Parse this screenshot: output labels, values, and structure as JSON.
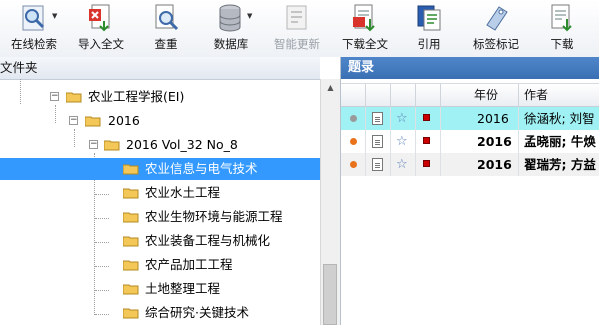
{
  "toolbar": {
    "items": [
      {
        "label": "在线检索",
        "icon": "online-search-icon",
        "enabled": true,
        "dropdown": true
      },
      {
        "label": "导入全文",
        "icon": "import-fulltext-icon",
        "enabled": true
      },
      {
        "label": "查重",
        "icon": "duplicate-check-icon",
        "enabled": true
      },
      {
        "label": "数据库",
        "icon": "database-icon",
        "enabled": true,
        "dropdown": true
      },
      {
        "label": "智能更新",
        "icon": "smart-update-icon",
        "enabled": false
      },
      {
        "label": "下载全文",
        "icon": "download-fulltext-icon",
        "enabled": true
      },
      {
        "label": "引用",
        "icon": "cite-icon",
        "enabled": true
      },
      {
        "label": "标签标记",
        "icon": "tag-icon",
        "enabled": true
      },
      {
        "label": "下载",
        "icon": "download-icon",
        "enabled": true
      }
    ]
  },
  "left_panel": {
    "title": "文件夹",
    "tree": [
      {
        "label": "农业工程学报(EI)",
        "expanded": true
      },
      {
        "label": "2016",
        "expanded": true
      },
      {
        "label": "2016 Vol_32 No_8",
        "expanded": true
      },
      {
        "label": "农业信息与电气技术",
        "selected": true
      },
      {
        "label": "农业水土工程"
      },
      {
        "label": "农业生物环境与能源工程"
      },
      {
        "label": "农业装备工程与机械化"
      },
      {
        "label": "农产品加工工程"
      },
      {
        "label": "土地整理工程"
      },
      {
        "label": "综合研究·关键技术"
      }
    ]
  },
  "right_panel": {
    "title": "题录",
    "columns": {
      "year": "年份",
      "author": "作者"
    },
    "rows": [
      {
        "status_color": "#9a9a9a",
        "year": "2016",
        "author": "徐涵秋; 刘智",
        "bold": false,
        "highlight": true
      },
      {
        "status_color": "#e8731a",
        "year": "2016",
        "author": "孟晓丽; 牛焕",
        "bold": true,
        "highlight": false
      },
      {
        "status_color": "#e8731a",
        "year": "2016",
        "author": "翟瑞芳; 方益",
        "bold": true,
        "highlight": false
      }
    ]
  }
}
